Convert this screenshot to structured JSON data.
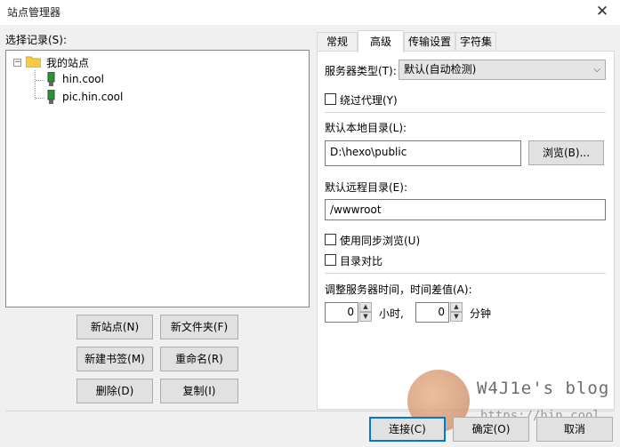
{
  "window": {
    "title": "站点管理器",
    "close_glyph": "✕"
  },
  "left": {
    "select_label": "选择记录(S):",
    "tree": {
      "expander_glyph": "−",
      "root": "我的站点",
      "sites": [
        "hin.cool",
        "pic.hin.cool"
      ]
    },
    "buttons": {
      "new_site": "新站点(N)",
      "new_folder": "新文件夹(F)",
      "new_bookmark": "新建书签(M)",
      "rename": "重命名(R)",
      "delete": "删除(D)",
      "copy": "复制(I)"
    }
  },
  "tabs": [
    "常规",
    "高级",
    "传输设置",
    "字符集"
  ],
  "active_tab": "高级",
  "advanced": {
    "server_type_label": "服务器类型(T):",
    "server_type_value": "默认(自动检测)",
    "bypass_proxy_label": "绕过代理(Y)",
    "local_dir_label": "默认本地目录(L):",
    "local_dir_value": "D:\\hexo\\public",
    "browse_button": "浏览(B)...",
    "remote_dir_label": "默认远程目录(E):",
    "remote_dir_value": "/wwwroot",
    "sync_browse_label": "使用同步浏览(U)",
    "dir_compare_label": "目录对比",
    "time_adjust_label": "调整服务器时间，时间差值(A):",
    "hours_value": "0",
    "hours_unit": "小时,",
    "minutes_value": "0",
    "minutes_unit": "分钟"
  },
  "footer": {
    "connect": "连接(C)",
    "ok": "确定(O)",
    "cancel": "取消"
  },
  "watermark": {
    "text": "W4J1e's blog",
    "url": "https://hin.cool"
  }
}
